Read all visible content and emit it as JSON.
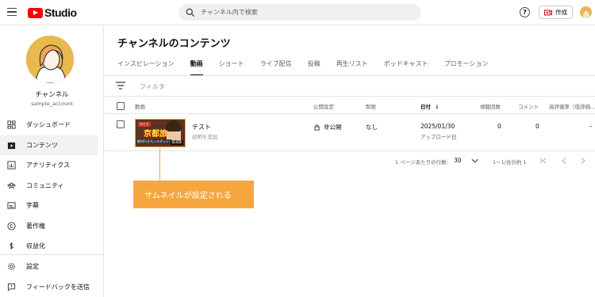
{
  "app": {
    "logo_text": "Studio",
    "brand_color": "#ff0000"
  },
  "search": {
    "placeholder": "チャンネル内で検索"
  },
  "header": {
    "help_symbol": "?",
    "create_label": "作成"
  },
  "sidebar": {
    "channel_name": "チャンネル",
    "channel_handle": "sample_account",
    "items": [
      {
        "label": "ダッシュボード",
        "icon": "dashboard-icon"
      },
      {
        "label": "コンテンツ",
        "icon": "content-icon",
        "active": true
      },
      {
        "label": "アナリティクス",
        "icon": "analytics-icon"
      },
      {
        "label": "コミュニティ",
        "icon": "community-icon"
      },
      {
        "label": "字幕",
        "icon": "subtitles-icon"
      },
      {
        "label": "著作権",
        "icon": "copyright-icon"
      },
      {
        "label": "収益化",
        "icon": "dollar-icon"
      }
    ],
    "bottom_items": [
      {
        "label": "設定",
        "icon": "gear-icon"
      },
      {
        "label": "フィードバックを送信",
        "icon": "feedback-icon"
      }
    ]
  },
  "main": {
    "title": "チャンネルのコンテンツ",
    "tabs": [
      {
        "label": "インスピレーション"
      },
      {
        "label": "動画",
        "active": true
      },
      {
        "label": "ショート"
      },
      {
        "label": "ライブ配信"
      },
      {
        "label": "投稿"
      },
      {
        "label": "再生リスト"
      },
      {
        "label": "ポッドキャスト"
      },
      {
        "label": "プロモーション"
      }
    ],
    "filter_placeholder": "フィルタ",
    "columns": {
      "video": "動画",
      "visibility": "公開設定",
      "restrictions": "制限",
      "date": "日付",
      "date_sort_arrow": "↓",
      "views": "視聴回数",
      "comments": "コメント",
      "likes": "高評価率（低評価..."
    },
    "rows": [
      {
        "title": "テスト",
        "description": "説明を追加",
        "duration": "0:09",
        "thumb_text": "京都旅",
        "thumb_tag": "ひとり",
        "thumb_sub": "絶対行きたいスポット!",
        "visibility": "非公開",
        "restrictions": "なし",
        "date": "2025/01/30",
        "date_status": "アップロード日",
        "views": "0",
        "comments": "0",
        "likes": "–"
      }
    ],
    "pager": {
      "rows_label": "1 ページあたりの行数:",
      "rows_value": "30",
      "range": "1〜1/合計約 1"
    }
  },
  "annotation": {
    "callout_text": "サムネイルが設定される",
    "color": "#f6a63e"
  }
}
